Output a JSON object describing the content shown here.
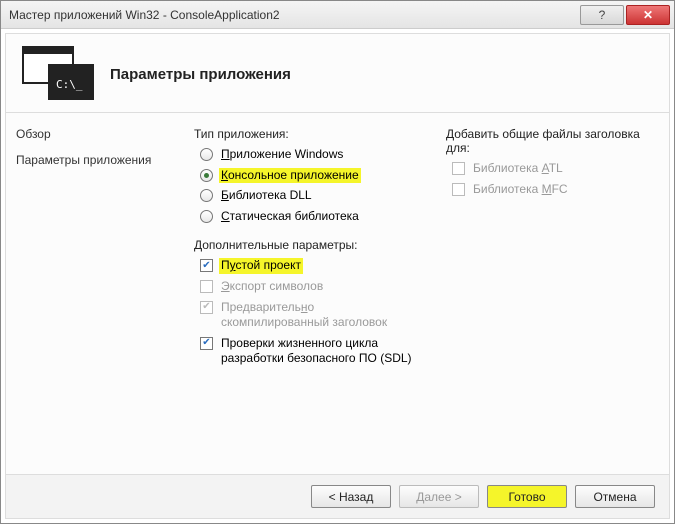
{
  "window": {
    "title": "Мастер приложений Win32 - ConsoleApplication2"
  },
  "header": {
    "title": "Параметры приложения",
    "icon_prompt": "C:\\_"
  },
  "nav": {
    "overview": "Обзор",
    "settings": "Параметры приложения"
  },
  "app_type": {
    "label": "Тип приложения:",
    "windows": "Приложение Windows",
    "console": "Консольное приложение",
    "dll": "Библиотека DLL",
    "static_lib": "Статическая библиотека"
  },
  "add_params": {
    "label": "Дополнительные параметры:",
    "empty": "Пустой проект",
    "export_symbols": "Экспорт символов",
    "precompiled": "Предварительно скомпилированный заголовок",
    "sdl": "Проверки жизненного цикла разработки безопасного ПО (SDL)"
  },
  "headers": {
    "label": "Добавить общие файлы заголовка для:",
    "atl": "Библиотека ATL",
    "mfc": "Библиотека MFC"
  },
  "footer": {
    "back": "< Назад",
    "next": "Далее >",
    "finish": "Готово",
    "cancel": "Отмена"
  }
}
